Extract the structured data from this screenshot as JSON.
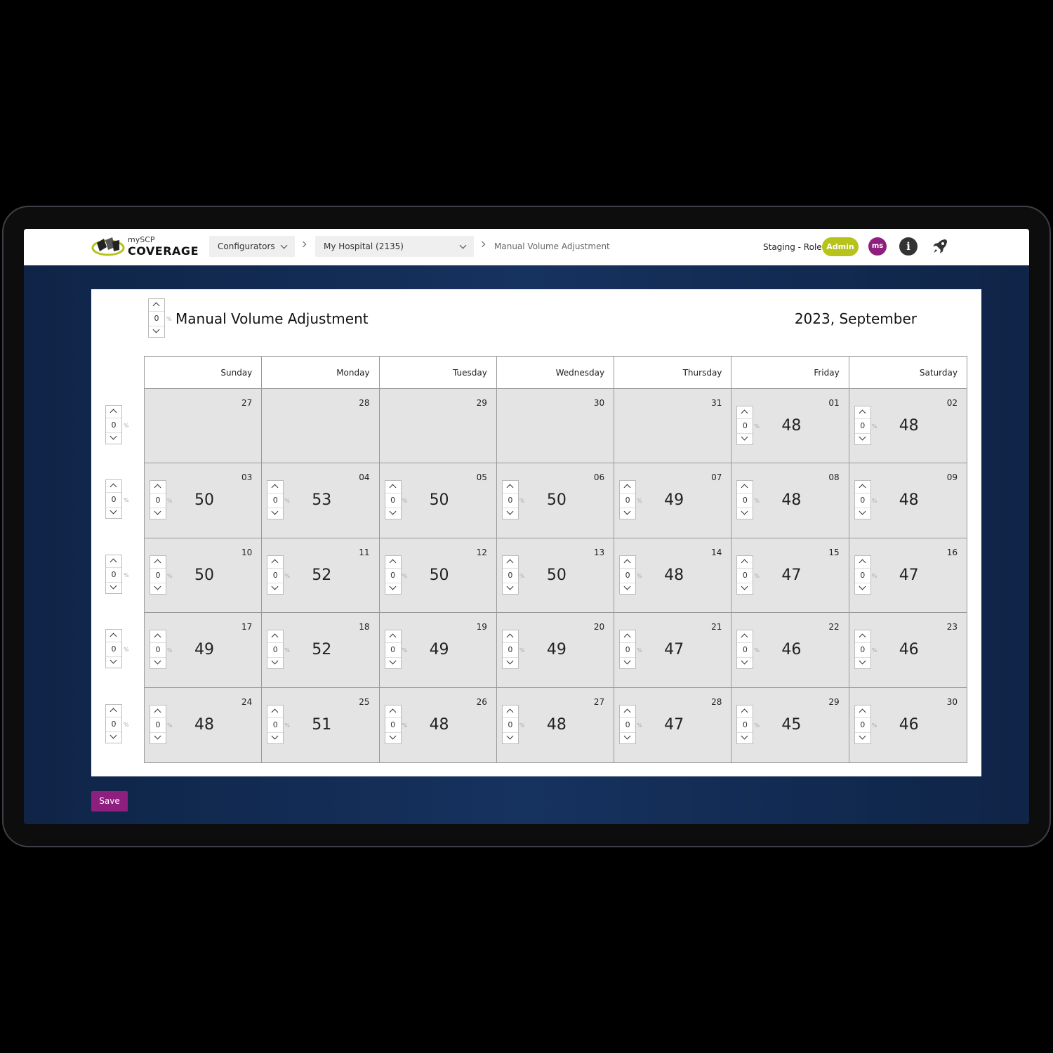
{
  "logo": {
    "small": "mySCP",
    "big": "COVERAGE"
  },
  "breadcrumb": {
    "configurators": "Configurators",
    "hospital": "My Hospital (2135)",
    "current": "Manual Volume Adjustment"
  },
  "header": {
    "role_label": "Staging - Role:",
    "role": "Admin",
    "avatar": "ms",
    "info": "i"
  },
  "page": {
    "title": "Manual Volume Adjustment",
    "month": "2023, September",
    "title_adjust": "0",
    "pct": "%"
  },
  "weekdays": [
    "Sunday",
    "Monday",
    "Tuesday",
    "Wednesday",
    "Thursday",
    "Friday",
    "Saturday"
  ],
  "weeks": [
    {
      "adjust": "0",
      "days": [
        {
          "num": "27",
          "value": null,
          "adjust": null
        },
        {
          "num": "28",
          "value": null,
          "adjust": null
        },
        {
          "num": "29",
          "value": null,
          "adjust": null
        },
        {
          "num": "30",
          "value": null,
          "adjust": null
        },
        {
          "num": "31",
          "value": null,
          "adjust": null
        },
        {
          "num": "01",
          "value": "48",
          "adjust": "0"
        },
        {
          "num": "02",
          "value": "48",
          "adjust": "0"
        }
      ]
    },
    {
      "adjust": "0",
      "days": [
        {
          "num": "03",
          "value": "50",
          "adjust": "0"
        },
        {
          "num": "04",
          "value": "53",
          "adjust": "0"
        },
        {
          "num": "05",
          "value": "50",
          "adjust": "0"
        },
        {
          "num": "06",
          "value": "50",
          "adjust": "0"
        },
        {
          "num": "07",
          "value": "49",
          "adjust": "0"
        },
        {
          "num": "08",
          "value": "48",
          "adjust": "0"
        },
        {
          "num": "09",
          "value": "48",
          "adjust": "0"
        }
      ]
    },
    {
      "adjust": "0",
      "days": [
        {
          "num": "10",
          "value": "50",
          "adjust": "0"
        },
        {
          "num": "11",
          "value": "52",
          "adjust": "0"
        },
        {
          "num": "12",
          "value": "50",
          "adjust": "0"
        },
        {
          "num": "13",
          "value": "50",
          "adjust": "0"
        },
        {
          "num": "14",
          "value": "48",
          "adjust": "0"
        },
        {
          "num": "15",
          "value": "47",
          "adjust": "0"
        },
        {
          "num": "16",
          "value": "47",
          "adjust": "0"
        }
      ]
    },
    {
      "adjust": "0",
      "days": [
        {
          "num": "17",
          "value": "49",
          "adjust": "0"
        },
        {
          "num": "18",
          "value": "52",
          "adjust": "0"
        },
        {
          "num": "19",
          "value": "49",
          "adjust": "0"
        },
        {
          "num": "20",
          "value": "49",
          "adjust": "0"
        },
        {
          "num": "21",
          "value": "47",
          "adjust": "0"
        },
        {
          "num": "22",
          "value": "46",
          "adjust": "0"
        },
        {
          "num": "23",
          "value": "46",
          "adjust": "0"
        }
      ]
    },
    {
      "adjust": "0",
      "days": [
        {
          "num": "24",
          "value": "48",
          "adjust": "0"
        },
        {
          "num": "25",
          "value": "51",
          "adjust": "0"
        },
        {
          "num": "26",
          "value": "48",
          "adjust": "0"
        },
        {
          "num": "27",
          "value": "48",
          "adjust": "0"
        },
        {
          "num": "28",
          "value": "47",
          "adjust": "0"
        },
        {
          "num": "29",
          "value": "45",
          "adjust": "0"
        },
        {
          "num": "30",
          "value": "46",
          "adjust": "0"
        }
      ]
    }
  ],
  "actions": {
    "save": "Save"
  },
  "colors": {
    "accent": "#8e1f7f",
    "role_badge": "#b7c21b",
    "background": "#13294d"
  }
}
